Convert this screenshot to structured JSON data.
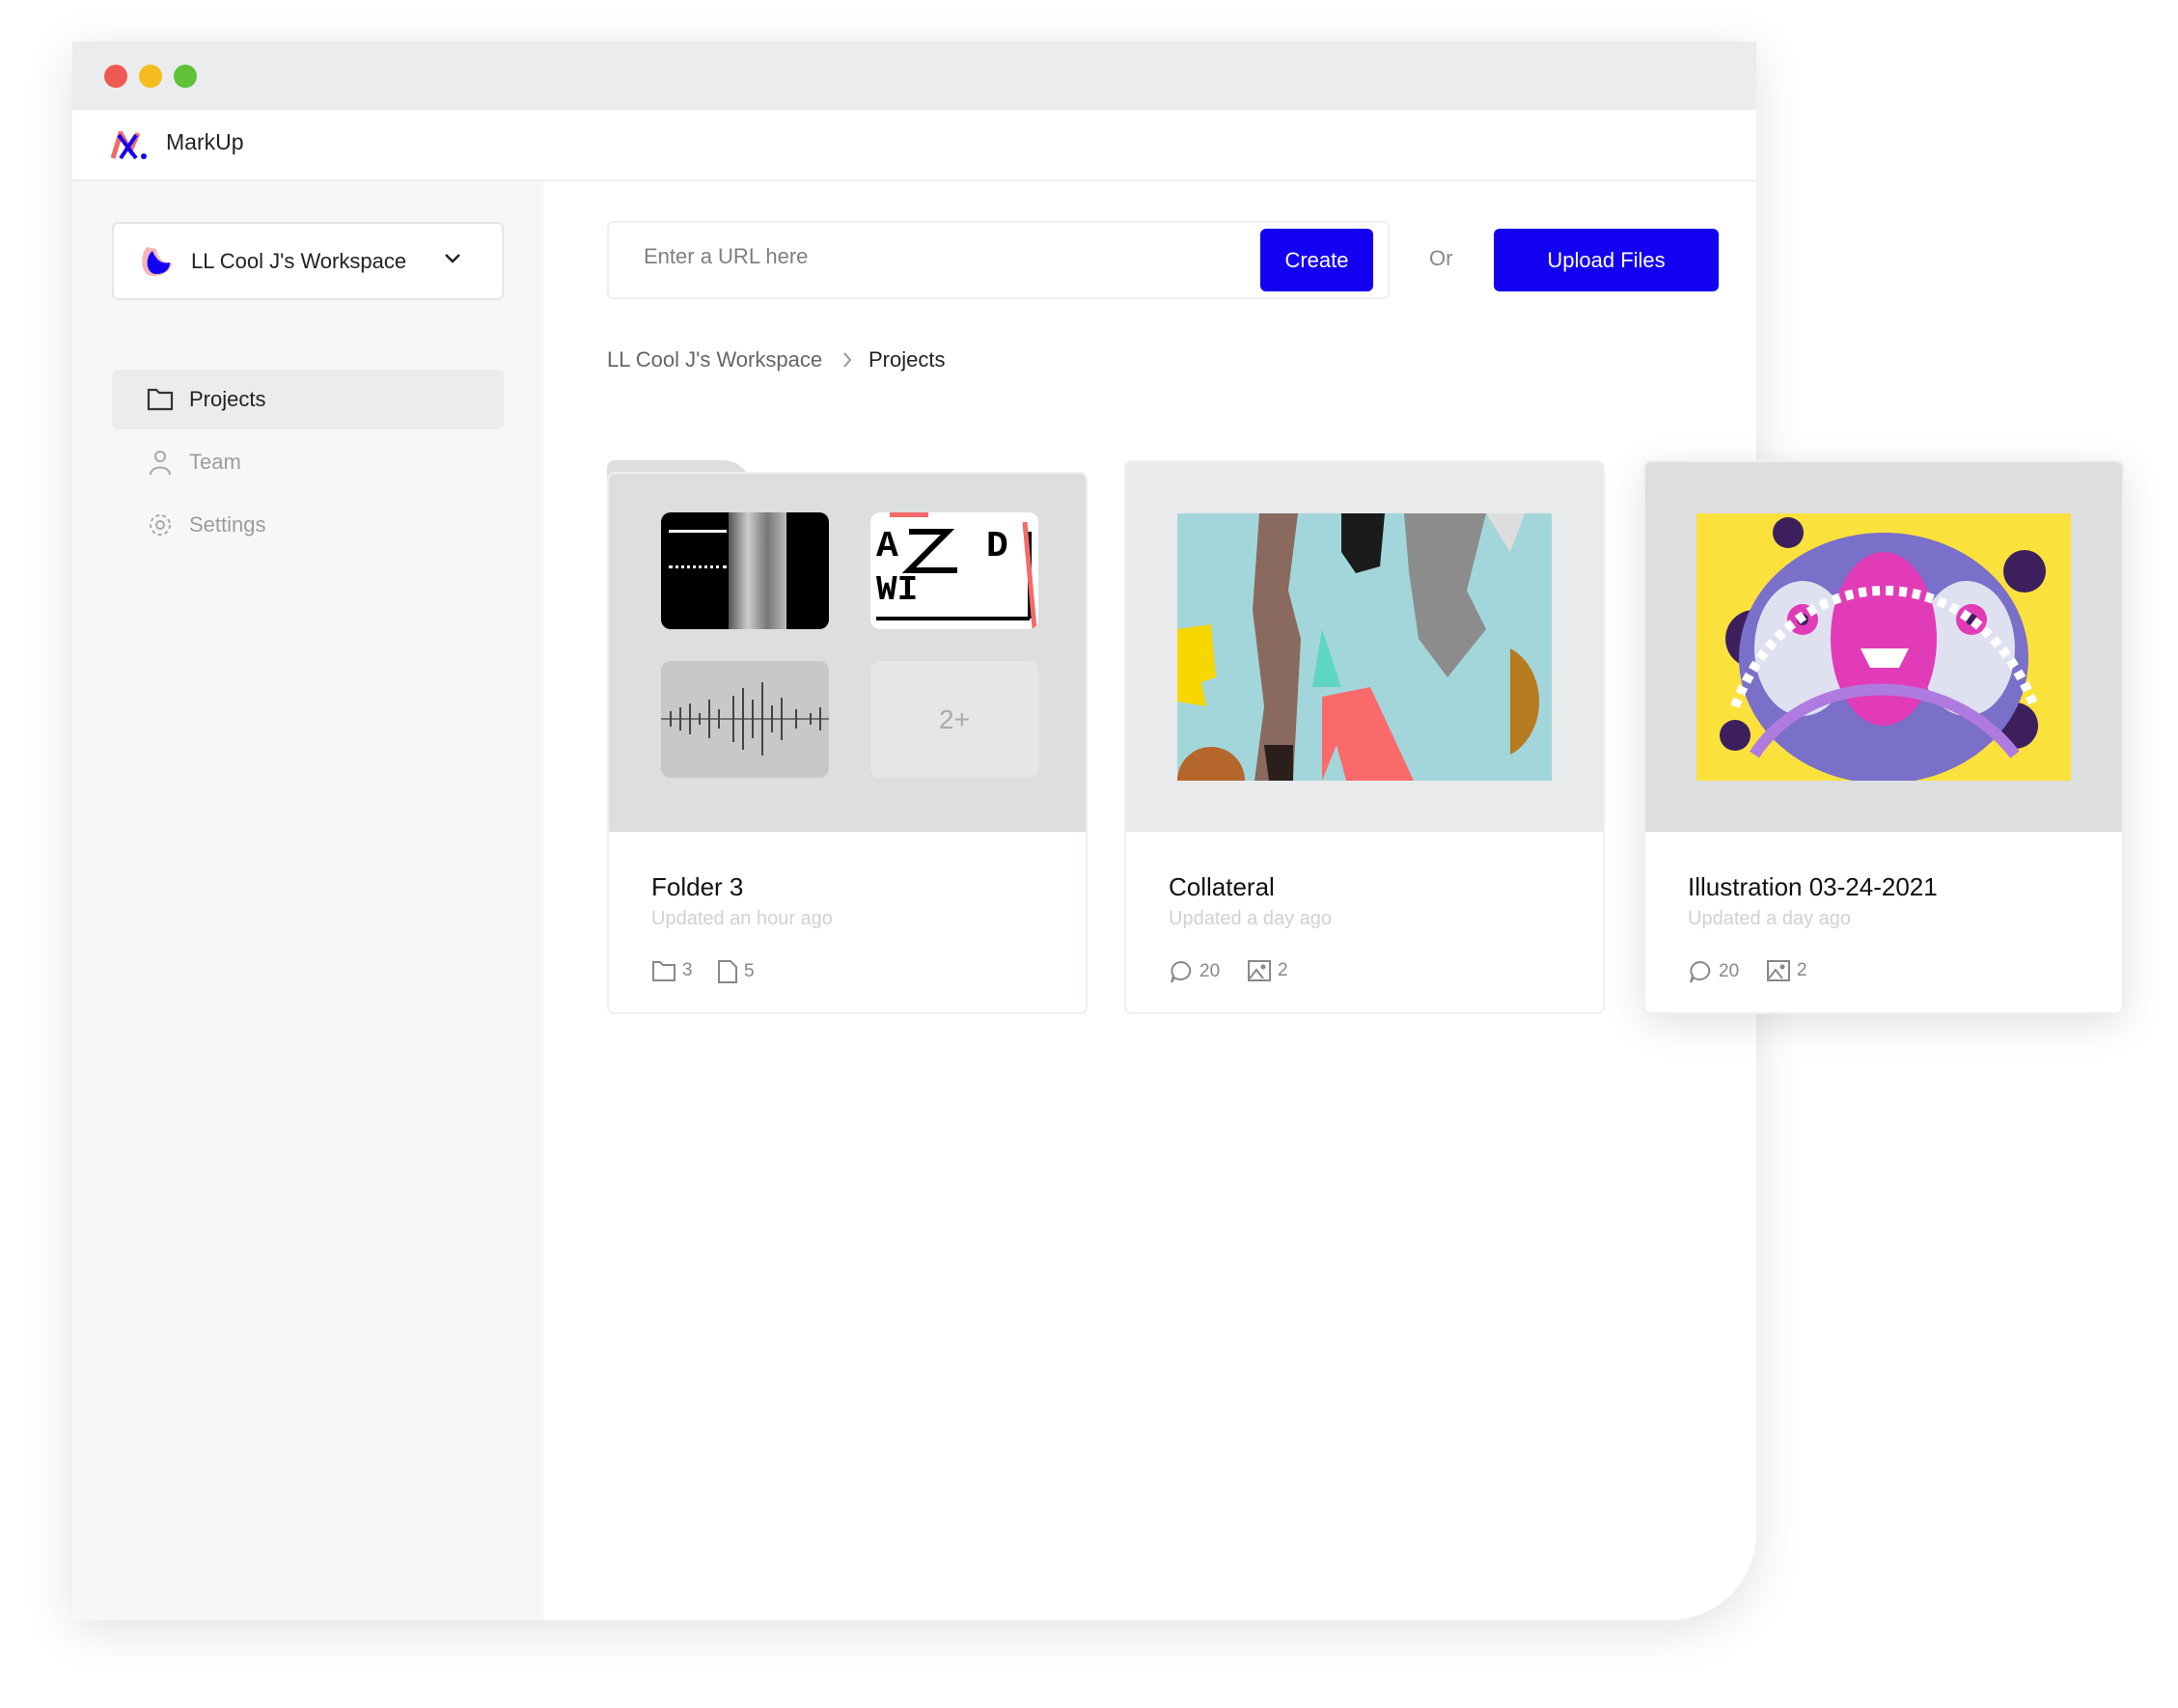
{
  "app": {
    "name": "MarkUp"
  },
  "window_controls": [
    "close",
    "minimize",
    "maximize"
  ],
  "sidebar": {
    "workspace": "LL Cool J's Workspace",
    "items": [
      {
        "label": "Projects",
        "icon": "folder-icon",
        "active": true
      },
      {
        "label": "Team",
        "icon": "user-icon"
      },
      {
        "label": "Settings",
        "icon": "gear-icon"
      }
    ]
  },
  "toolbar": {
    "url_placeholder": "Enter a URL here",
    "create_label": "Create",
    "or_label": "Or",
    "upload_label": "Upload Files"
  },
  "breadcrumb": [
    "LL Cool J's Workspace",
    "Projects"
  ],
  "cards": [
    {
      "title": "Folder 3",
      "updated": "Updated an hour ago",
      "stat1": "3",
      "stat2": "5",
      "more": "2+",
      "type": "folder"
    },
    {
      "title": "Collateral",
      "updated": "Updated a day ago",
      "stat1": "20",
      "stat2": "2",
      "type": "project"
    },
    {
      "title": "Illustration 03-24-2021",
      "updated": "Updated a day ago",
      "stat1": "20",
      "stat2": "2",
      "type": "project"
    }
  ],
  "colors": {
    "accent": "#1400f0",
    "sidebar_bg": "#f6f7f8",
    "close": "#ee5a52",
    "minimize": "#f5bd1f",
    "maximize": "#5fc238"
  }
}
